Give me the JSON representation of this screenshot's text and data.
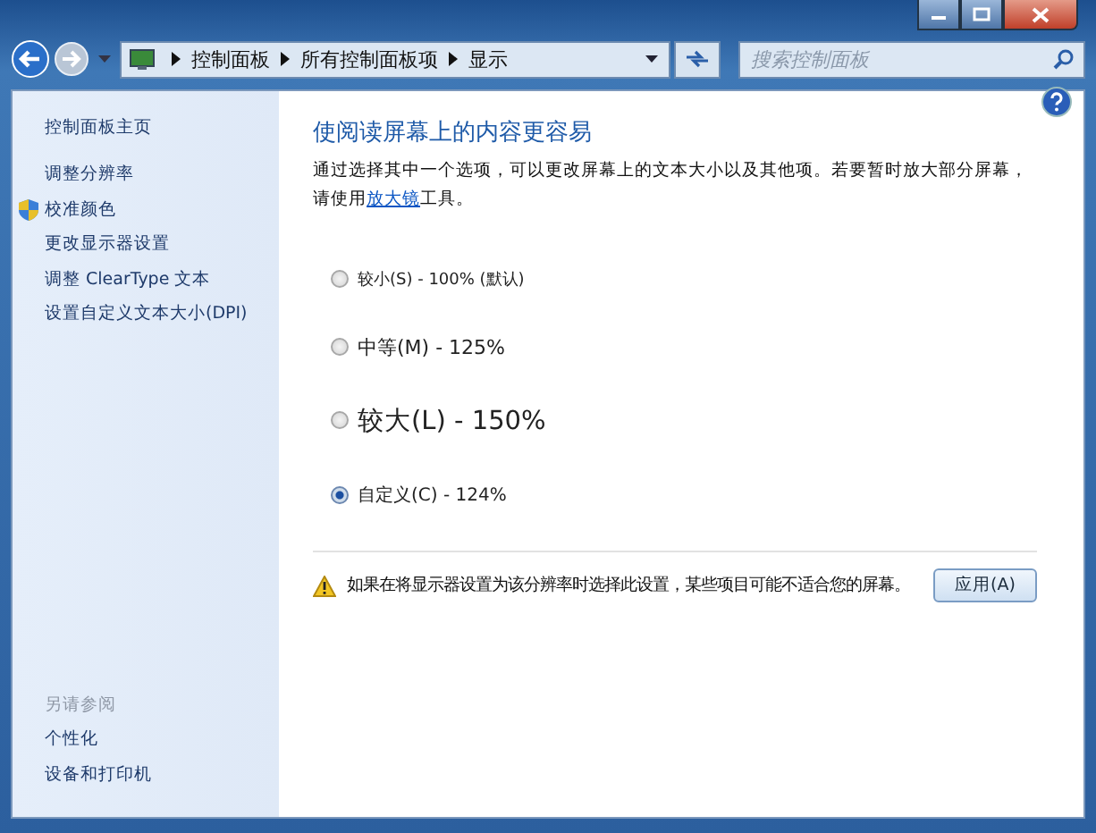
{
  "address_bar": {
    "breadcrumbs": [
      "控制面板",
      "所有控制面板项",
      "显示"
    ]
  },
  "search": {
    "placeholder": "搜索控制面板"
  },
  "sidebar": {
    "home": "控制面板主页",
    "items": [
      {
        "label": "调整分辨率",
        "kind": "plain"
      },
      {
        "label": "校准颜色",
        "kind": "shield"
      },
      {
        "label": "更改显示器设置",
        "kind": "plain"
      },
      {
        "label": "调整 ClearType 文本",
        "kind": "plain"
      },
      {
        "label": "设置自定义文本大小(DPI)",
        "kind": "plain"
      }
    ],
    "see_also": {
      "title": "另请参阅",
      "items": [
        "个性化",
        "设备和打印机"
      ]
    }
  },
  "main": {
    "heading": "使阅读屏幕上的内容更容易",
    "description": {
      "text": "通过选择其中一个选项，可以更改屏幕上的文本大小以及其他项。若要暂时放大部分屏幕，请使用",
      "link": "放大镜",
      "text_after": "工具。"
    },
    "options": [
      {
        "label": "较小(S) - 100% (默认)",
        "kind": "small",
        "selected": false
      },
      {
        "label": "中等(M) - 125%",
        "kind": "medium",
        "selected": false
      },
      {
        "label": "较大(L) - 150%",
        "kind": "large",
        "selected": false
      },
      {
        "label": "自定义(C) - 124%",
        "kind": "custom",
        "selected": true
      }
    ],
    "warning": "如果在将显示器设置为该分辨率时选择此设置，某些项目可能不适合您的屏幕。",
    "apply_button": "应用(A)"
  }
}
